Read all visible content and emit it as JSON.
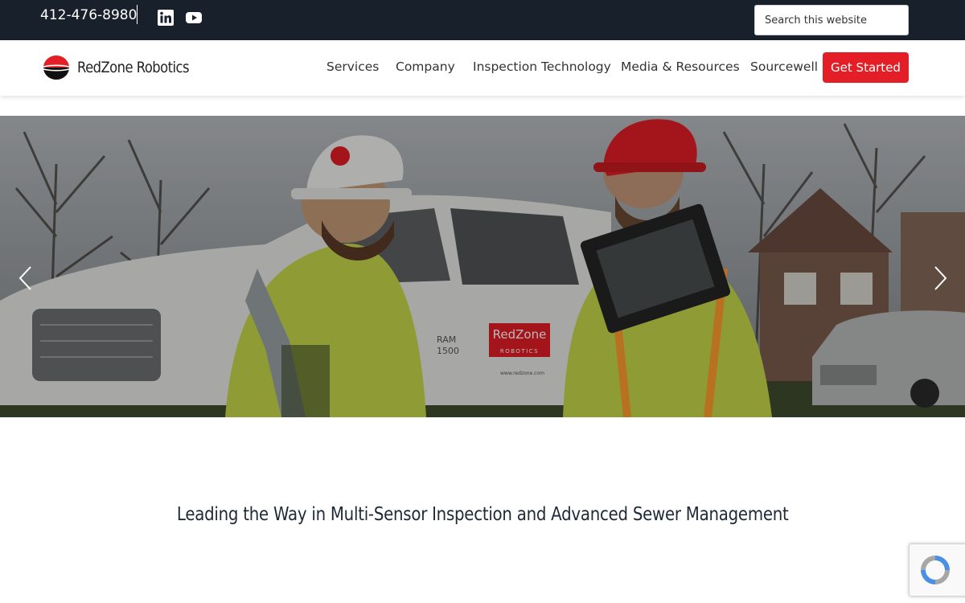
{
  "topbar": {
    "phone": "412-476-8980",
    "social": [
      "linkedin-icon",
      "youtube-icon"
    ],
    "search_placeholder": "Search this website"
  },
  "header": {
    "logo_text": "RedZone Robotics",
    "nav": [
      "Services",
      "Company",
      "Inspection Technology",
      "Media & Resources",
      "Sourcewell"
    ],
    "cta": "Get Started"
  },
  "hero": {
    "truck_logo_line1": "RedZone",
    "truck_logo_line2": "ROBOTICS",
    "truck_badge": "RAM",
    "truck_badge2": "1500",
    "truck_url": "www.redzone.com"
  },
  "main": {
    "tagline": "Leading the Way in Multi-Sensor Inspection and Advanced Sewer Management"
  },
  "colors": {
    "topbar": "#18202b",
    "accent": "#e41e26",
    "heading": "#1e2a36"
  }
}
